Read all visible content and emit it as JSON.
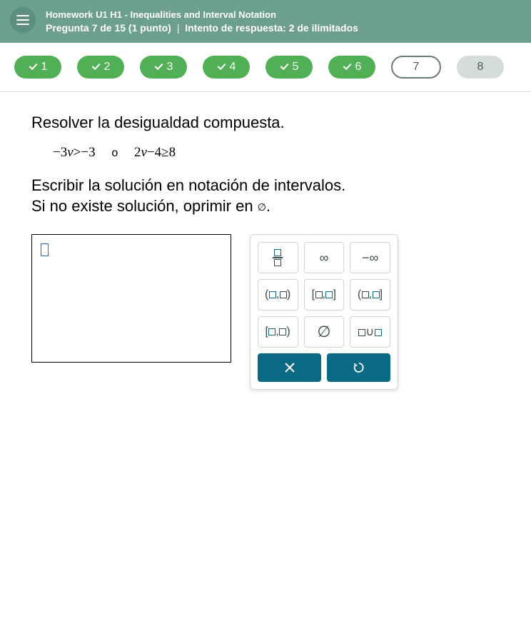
{
  "header": {
    "title": "Homework U1 H1 - Inequalities and Interval Notation",
    "question_label": "Pregunta 7 de 15 (1 punto)",
    "attempt_label": "Intento de respuesta: 2 de ilimitados"
  },
  "nav": {
    "items": [
      {
        "num": "1",
        "state": "done"
      },
      {
        "num": "2",
        "state": "done"
      },
      {
        "num": "3",
        "state": "done"
      },
      {
        "num": "4",
        "state": "done"
      },
      {
        "num": "5",
        "state": "done"
      },
      {
        "num": "6",
        "state": "done"
      },
      {
        "num": "7",
        "state": "current"
      },
      {
        "num": "8",
        "state": "future"
      }
    ]
  },
  "question": {
    "heading": "Resolver la desigualdad compuesta.",
    "expr_left_a": "−3",
    "expr_left_var": "v",
    "expr_left_op": ">",
    "expr_left_b": "−3",
    "connector": "o",
    "expr_right_a": "2",
    "expr_right_var": "v",
    "expr_right_mid": "−4",
    "expr_right_op": "≥",
    "expr_right_b": "8",
    "instr_line1": "Escribir la solución en notación de intervalos.",
    "instr_line2_a": "Si no existe solución, oprimir en ",
    "instr_line2_sym": "∅",
    "instr_line2_b": "."
  },
  "keypad": {
    "infinity": "∞",
    "neg_infinity": "−∞",
    "open_open": "(□,□)",
    "closed_closed": "[□,□]",
    "open_closed": "(□,□]",
    "closed_open": "[□,□)",
    "emptyset": "∅",
    "union": "□∪□",
    "clear": "×",
    "undo": "↺"
  }
}
